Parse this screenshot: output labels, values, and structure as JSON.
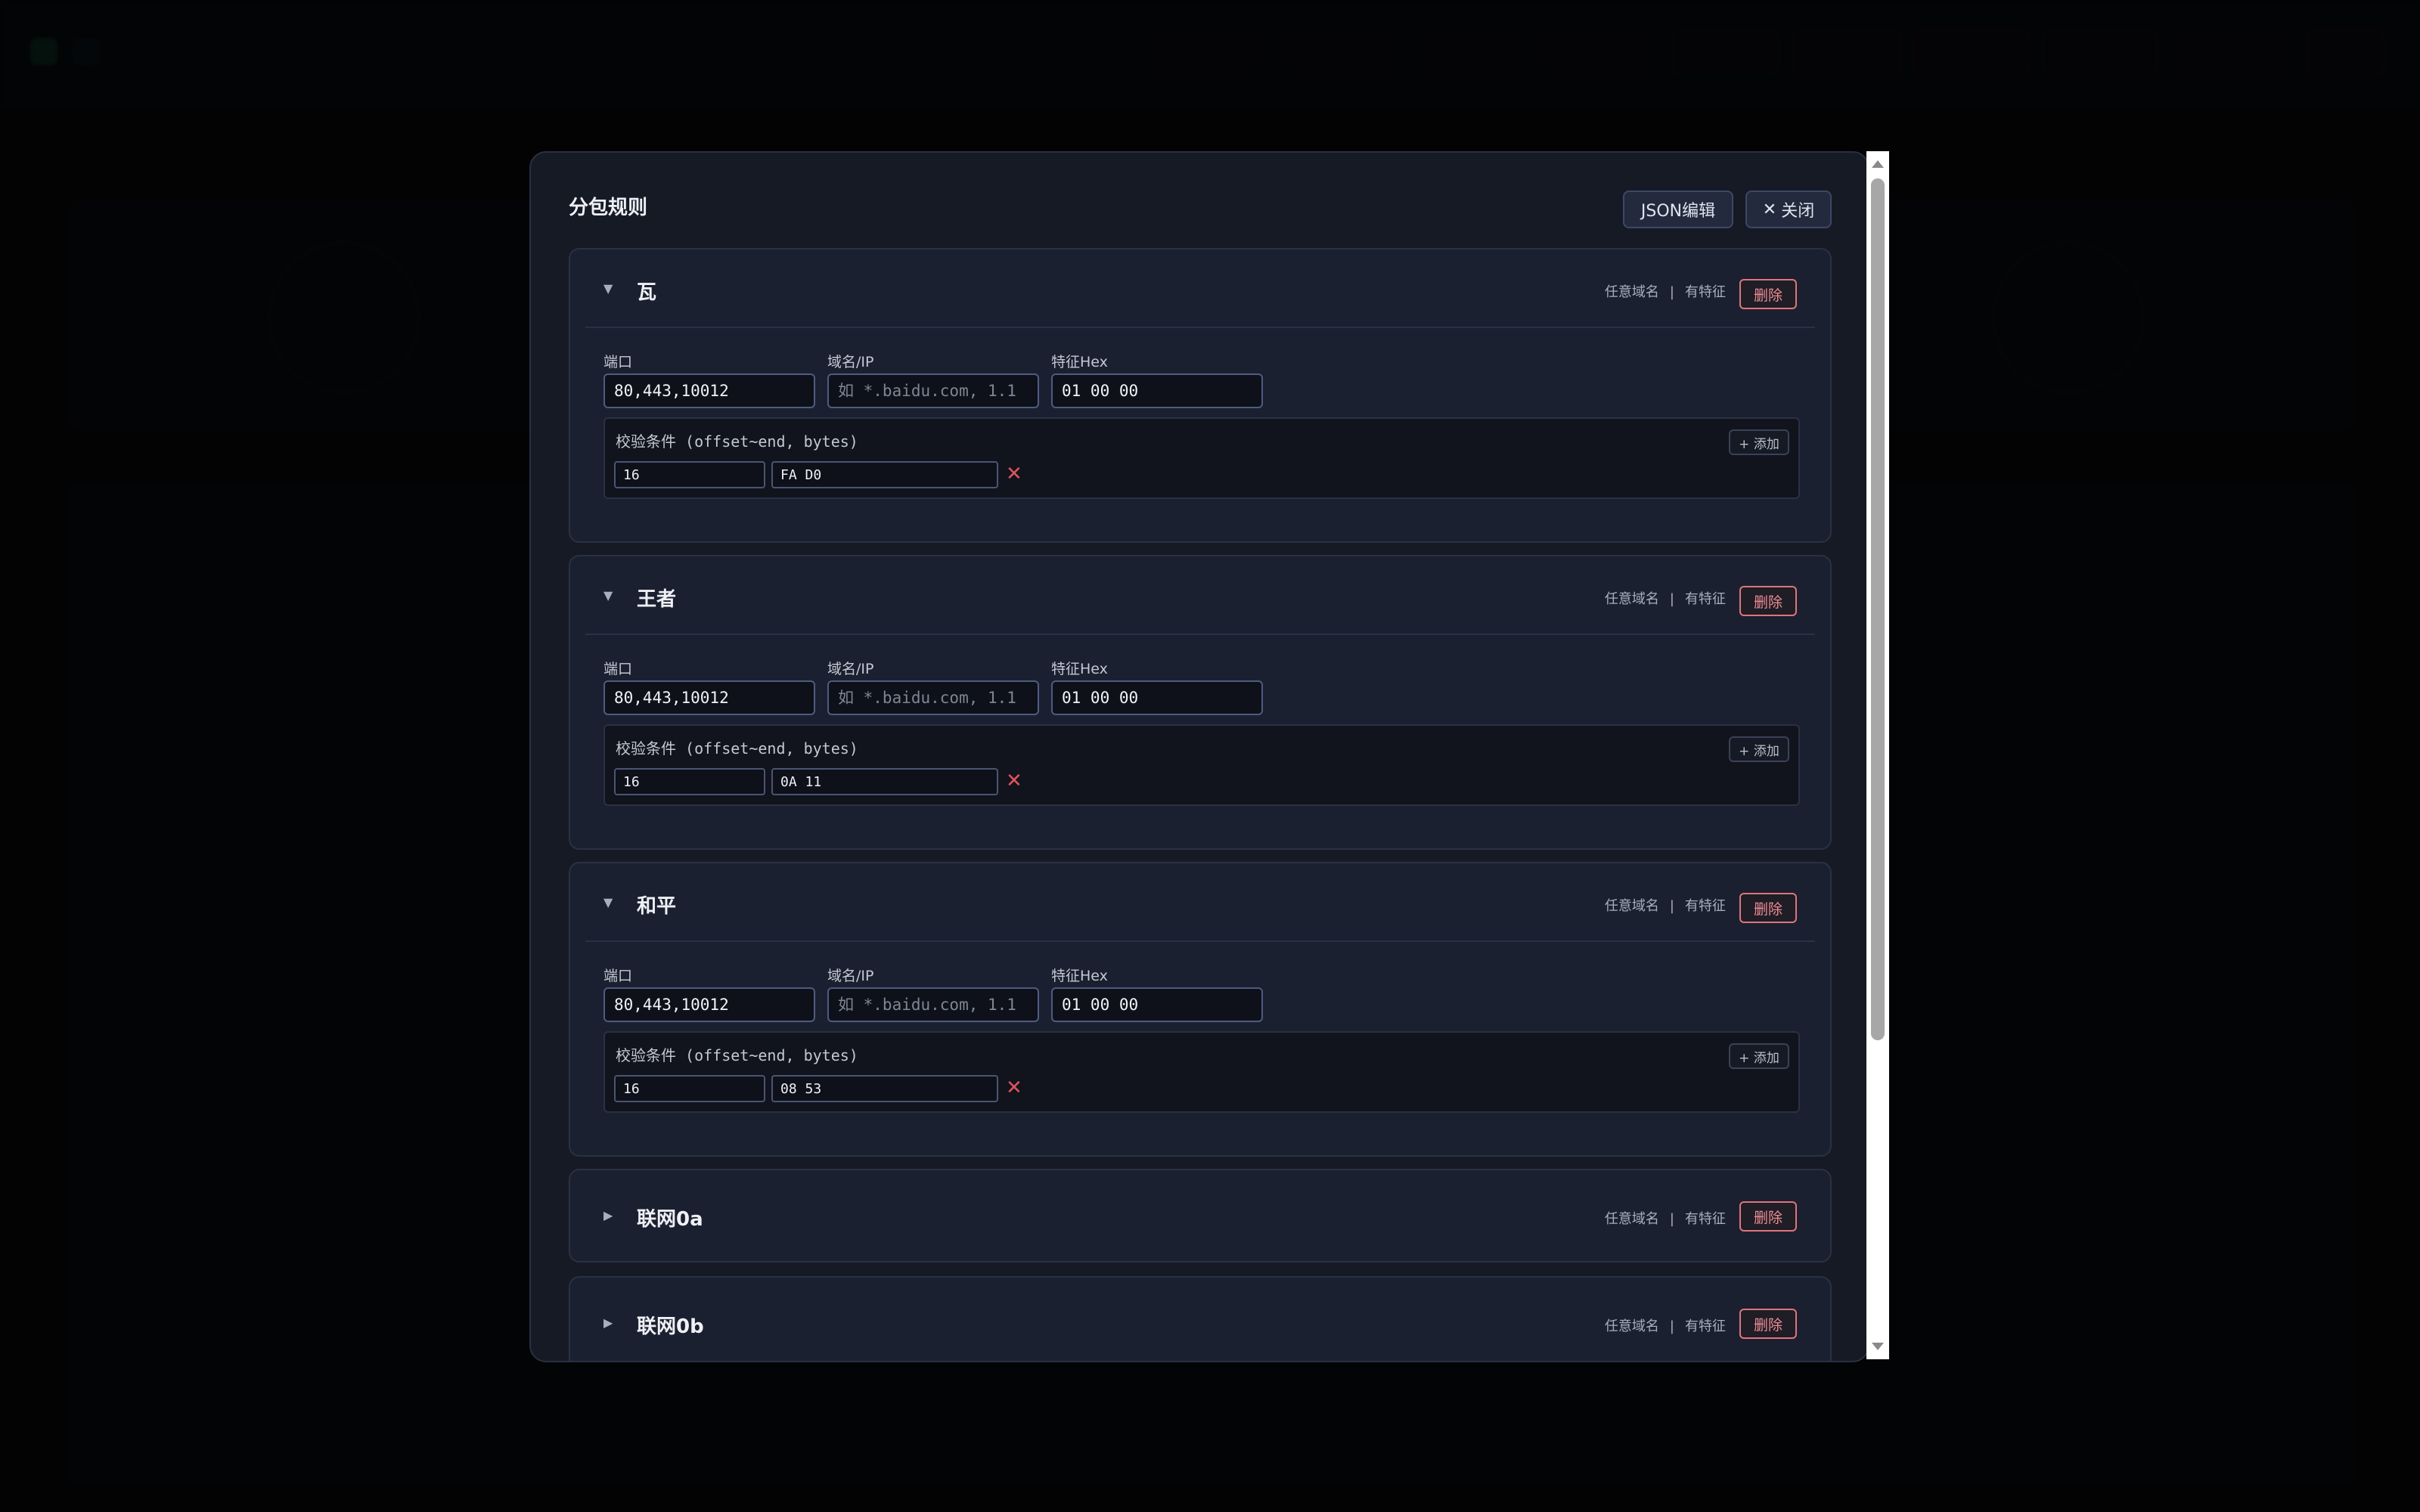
{
  "modal": {
    "title": "分包规则",
    "json_edit_label": "JSON编辑",
    "close_label": "关闭"
  },
  "rule_meta": {
    "domain_mode": "任意域名",
    "separator": "|",
    "feature_mode": "有特征",
    "delete_label": "删除"
  },
  "fields": {
    "port_label": "端口",
    "domain_label": "域名/IP",
    "domain_placeholder": "如 *.baidu.com, 1.1",
    "hex_label": "特征Hex",
    "checks_label": "校验条件 (offset~end, bytes)",
    "add_label": "+ 添加"
  },
  "rules": [
    {
      "name": "瓦",
      "expanded": true,
      "port": "80,443,10012",
      "domain": "",
      "hex": "01 00 00",
      "check_offset": "16",
      "check_bytes": "FA D0"
    },
    {
      "name": "王者",
      "expanded": true,
      "port": "80,443,10012",
      "domain": "",
      "hex": "01 00 00",
      "check_offset": "16",
      "check_bytes": "0A 11"
    },
    {
      "name": "和平",
      "expanded": true,
      "port": "80,443,10012",
      "domain": "",
      "hex": "01 00 00",
      "check_offset": "16",
      "check_bytes": "08 53"
    },
    {
      "name": "联网0a",
      "expanded": false
    },
    {
      "name": "联网0b",
      "expanded": false
    }
  ],
  "colors": {
    "delete": "#e0747c",
    "remove_x": "#e0535d",
    "accent_input_border": "#4f5c80"
  }
}
